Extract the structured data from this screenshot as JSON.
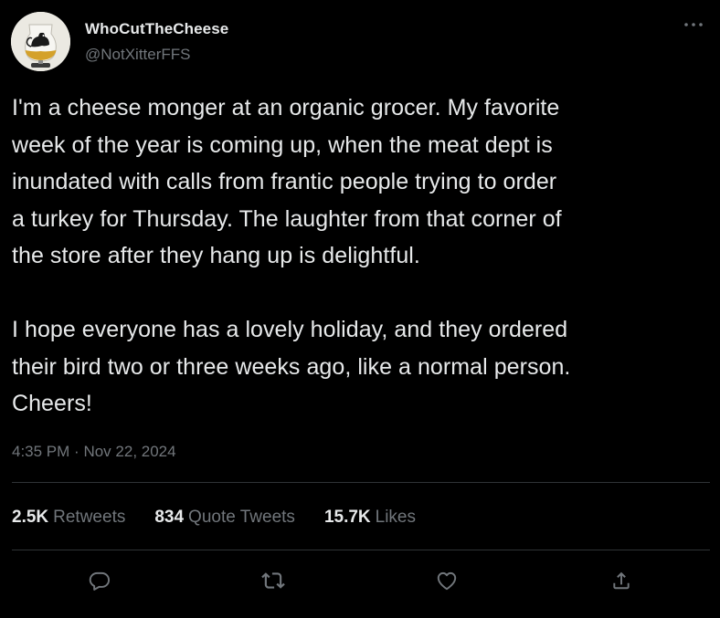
{
  "author": {
    "display_name": "WhoCutTheCheese",
    "handle": "@NotXitterFFS",
    "avatar_icon": "glencairn-glass-avatar"
  },
  "tweet": {
    "text": "I'm a cheese monger at an organic grocer. My favorite\nweek of the year is coming up, when the meat dept is\ninundated with calls from frantic people trying to order\na turkey for Thursday. The laughter from that corner of\nthe store after they hang up is delightful.\n\nI hope everyone has a lovely holiday, and they ordered\ntheir bird two or three weeks ago, like a normal person.\nCheers!",
    "time": "4:35 PM",
    "separator": "·",
    "date": "Nov 22, 2024"
  },
  "stats": {
    "retweets_count": "2.5K",
    "retweets_label": "Retweets",
    "quote_count": "834",
    "quote_label": "Quote Tweets",
    "likes_count": "15.7K",
    "likes_label": "Likes"
  },
  "actions": {
    "reply_icon": "reply-icon",
    "retweet_icon": "retweet-icon",
    "like_icon": "heart-icon",
    "share_icon": "share-icon",
    "more_icon": "more-dots-icon"
  },
  "colors": {
    "background": "#000000",
    "primary_text": "#e7e9ea",
    "secondary_text": "#71767b",
    "divider": "#2f3336"
  }
}
